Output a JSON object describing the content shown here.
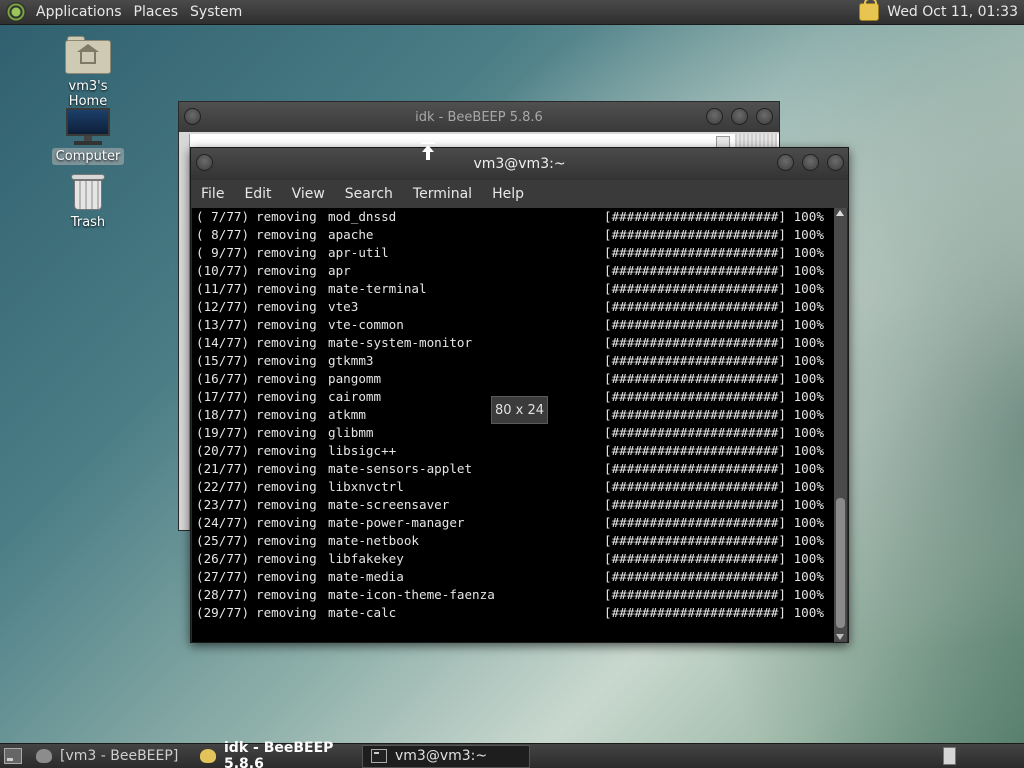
{
  "top_panel": {
    "menus": [
      "Applications",
      "Places",
      "System"
    ],
    "clock": "Wed Oct 11, 01:33"
  },
  "desktop": {
    "icons": [
      {
        "label": "vm3's Home",
        "icon": "home-folder-icon"
      },
      {
        "label": "Computer",
        "icon": "computer-icon"
      },
      {
        "label": "Trash",
        "icon": "trash-icon"
      }
    ]
  },
  "bee_window": {
    "title": "idk - BeeBEEP 5.8.6"
  },
  "terminal": {
    "title": "vm3@vm3:~",
    "menu": [
      "File",
      "Edit",
      "View",
      "Search",
      "Terminal",
      "Help"
    ],
    "size_tooltip": "80 x 24",
    "lines": [
      {
        "step": "( 7/77)",
        "action": "removing",
        "pkg": "mod_dnssd",
        "bar": "[######################]",
        "pct": "100%"
      },
      {
        "step": "( 8/77)",
        "action": "removing",
        "pkg": "apache",
        "bar": "[######################]",
        "pct": "100%"
      },
      {
        "step": "( 9/77)",
        "action": "removing",
        "pkg": "apr-util",
        "bar": "[######################]",
        "pct": "100%"
      },
      {
        "step": "(10/77)",
        "action": "removing",
        "pkg": "apr",
        "bar": "[######################]",
        "pct": "100%"
      },
      {
        "step": "(11/77)",
        "action": "removing",
        "pkg": "mate-terminal",
        "bar": "[######################]",
        "pct": "100%"
      },
      {
        "step": "(12/77)",
        "action": "removing",
        "pkg": "vte3",
        "bar": "[######################]",
        "pct": "100%"
      },
      {
        "step": "(13/77)",
        "action": "removing",
        "pkg": "vte-common",
        "bar": "[######################]",
        "pct": "100%"
      },
      {
        "step": "(14/77)",
        "action": "removing",
        "pkg": "mate-system-monitor",
        "bar": "[######################]",
        "pct": "100%"
      },
      {
        "step": "(15/77)",
        "action": "removing",
        "pkg": "gtkmm3",
        "bar": "[######################]",
        "pct": "100%"
      },
      {
        "step": "(16/77)",
        "action": "removing",
        "pkg": "pangomm",
        "bar": "[######################]",
        "pct": "100%"
      },
      {
        "step": "(17/77)",
        "action": "removing",
        "pkg": "cairomm",
        "bar": "[######################]",
        "pct": "100%"
      },
      {
        "step": "(18/77)",
        "action": "removing",
        "pkg": "atkmm",
        "bar": "[######################]",
        "pct": "100%"
      },
      {
        "step": "(19/77)",
        "action": "removing",
        "pkg": "glibmm",
        "bar": "[######################]",
        "pct": "100%"
      },
      {
        "step": "(20/77)",
        "action": "removing",
        "pkg": "libsigc++",
        "bar": "[######################]",
        "pct": "100%"
      },
      {
        "step": "(21/77)",
        "action": "removing",
        "pkg": "mate-sensors-applet",
        "bar": "[######################]",
        "pct": "100%"
      },
      {
        "step": "(22/77)",
        "action": "removing",
        "pkg": "libxnvctrl",
        "bar": "[######################]",
        "pct": "100%"
      },
      {
        "step": "(23/77)",
        "action": "removing",
        "pkg": "mate-screensaver",
        "bar": "[######################]",
        "pct": "100%"
      },
      {
        "step": "(24/77)",
        "action": "removing",
        "pkg": "mate-power-manager",
        "bar": "[######################]",
        "pct": "100%"
      },
      {
        "step": "(25/77)",
        "action": "removing",
        "pkg": "mate-netbook",
        "bar": "[######################]",
        "pct": "100%"
      },
      {
        "step": "(26/77)",
        "action": "removing",
        "pkg": "libfakekey",
        "bar": "[######################]",
        "pct": "100%"
      },
      {
        "step": "(27/77)",
        "action": "removing",
        "pkg": "mate-media",
        "bar": "[######################]",
        "pct": "100%"
      },
      {
        "step": "(28/77)",
        "action": "removing",
        "pkg": "mate-icon-theme-faenza",
        "bar": "[######################]",
        "pct": "100%"
      },
      {
        "step": "(29/77)",
        "action": "removing",
        "pkg": "mate-calc",
        "bar": "[######################]",
        "pct": "100%"
      }
    ]
  },
  "taskbar": {
    "tasks": [
      {
        "label": "[vm3 - BeeBEEP]",
        "icon": "beebeep-icon"
      },
      {
        "label": "idk - BeeBEEP 5.8.6",
        "icon": "beebeep-icon"
      },
      {
        "label": "vm3@vm3:~",
        "icon": "terminal-icon"
      }
    ]
  }
}
